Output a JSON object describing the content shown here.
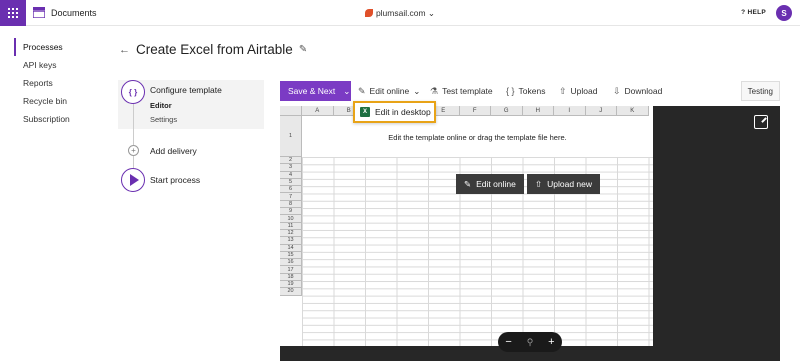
{
  "header": {
    "brand": "Documents",
    "domain": "plumsail.com",
    "help": "HELP",
    "avatar": "S"
  },
  "nav": {
    "items": [
      "Processes",
      "API keys",
      "Reports",
      "Recycle bin",
      "Subscription"
    ]
  },
  "page": {
    "title": "Create Excel from Airtable"
  },
  "steps": {
    "configure": "Configure template",
    "editor": "Editor",
    "settings": "Settings",
    "delivery": "Add delivery",
    "start": "Start process"
  },
  "toolbar": {
    "save_next": "Save & Next",
    "edit_online": "Edit online",
    "test_template": "Test template",
    "tokens": "Tokens",
    "upload": "Upload",
    "download": "Download",
    "testing": "Testing"
  },
  "dropdown": {
    "edit_desktop": "Edit in desktop"
  },
  "sheet": {
    "columns": [
      "A",
      "B",
      "C",
      "D",
      "E",
      "F",
      "G",
      "H",
      "I",
      "J",
      "K"
    ],
    "rows": [
      "1",
      "2",
      "3",
      "4",
      "5",
      "6",
      "7",
      "8",
      "9",
      "10",
      "11",
      "12",
      "13",
      "14",
      "15",
      "16",
      "17",
      "18",
      "19",
      "20"
    ],
    "hint": "Edit the template online or drag the template file here.",
    "edit_online_btn": "Edit online",
    "upload_new_btn": "Upload new"
  },
  "zoom": {
    "minus": "−",
    "plus": "+"
  },
  "colors": {
    "brand": "#6a2fb0",
    "highlight": "#e8a317"
  }
}
